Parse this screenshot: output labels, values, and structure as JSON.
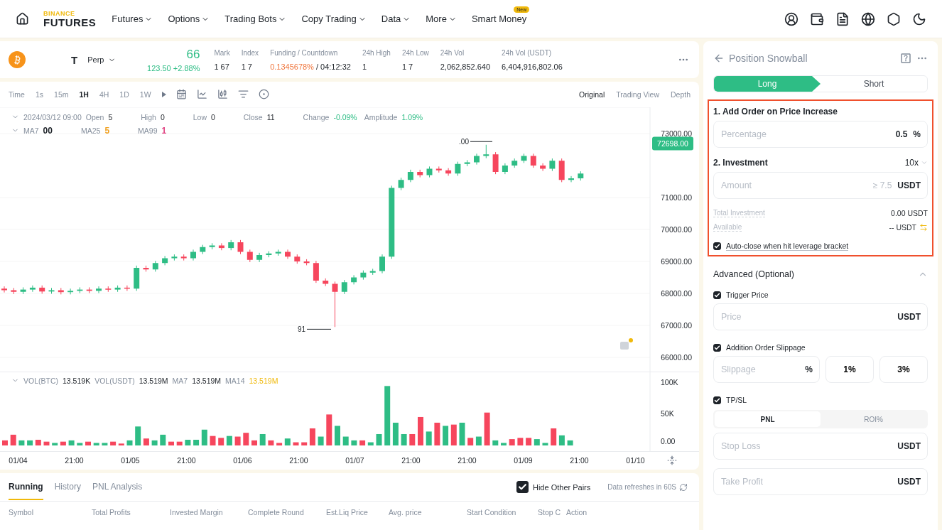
{
  "nav": {
    "logo_top": "BINANCE",
    "logo_bottom": "FUTURES",
    "items": [
      {
        "label": "Futures",
        "dropdown": true
      },
      {
        "label": "Options",
        "dropdown": true
      },
      {
        "label": "Trading Bots",
        "dropdown": true
      },
      {
        "label": "Copy Trading",
        "dropdown": true
      },
      {
        "label": "Data",
        "dropdown": true
      },
      {
        "label": "More",
        "dropdown": true
      },
      {
        "label": "Smart Money",
        "dropdown": false,
        "badge": "New"
      }
    ]
  },
  "ticker": {
    "symbol": "T",
    "contract": "Perp",
    "price": "66",
    "change": "123.50 +2.88%",
    "stats": [
      {
        "label": "Mark",
        "value": "1 67"
      },
      {
        "label": "Index",
        "value": "1 7"
      },
      {
        "label": "Funding / Countdown",
        "value": "0.1345678%",
        "value_2": "/ 04:12:32"
      },
      {
        "label": "24h High",
        "value": "1"
      },
      {
        "label": "24h Low",
        "value": "1 7"
      },
      {
        "label": "24h Vol",
        "value": "2,062,852.640"
      },
      {
        "label": "24h Vol (USDT)",
        "value": "6,404,916,802.06"
      }
    ]
  },
  "chart_toolbar": {
    "intervals": [
      {
        "label": "Time",
        "selected": false
      },
      {
        "label": "1s",
        "selected": false
      },
      {
        "label": "15m",
        "selected": false
      },
      {
        "label": "1H",
        "selected": true
      },
      {
        "label": "4H",
        "selected": false
      },
      {
        "label": "1D",
        "selected": false
      },
      {
        "label": "1W",
        "selected": false
      }
    ],
    "views": [
      {
        "label": "Original",
        "selected": true
      },
      {
        "label": "Trading View",
        "selected": false
      },
      {
        "label": "Depth",
        "selected": false
      }
    ]
  },
  "ohlc": {
    "date": "2024/03/12 09:00",
    "fields": [
      {
        "label": "Open",
        "value": "5",
        "kind": "plain"
      },
      {
        "label": "High",
        "value": "0",
        "kind": "plain"
      },
      {
        "label": "Low",
        "value": "0",
        "kind": "plain"
      },
      {
        "label": "Close",
        "value": "11",
        "kind": "plain"
      },
      {
        "label": "Change",
        "value": "-0.09%",
        "kind": "green"
      },
      {
        "label": "Amplitude",
        "value": "1.09%",
        "kind": "green"
      }
    ]
  },
  "ma": [
    {
      "label": "MA7",
      "value": "00",
      "color": "#1e2329"
    },
    {
      "label": "MA25",
      "value": "5",
      "color": "#f0a020"
    },
    {
      "label": "MA99",
      "value": "1",
      "color": "#e04080"
    }
  ],
  "price_axis": [
    "73000.00",
    "71000.00",
    "70000.00",
    "69000.00",
    "68000.00",
    "67000.00",
    "66000.00"
  ],
  "last_price": "72698.00",
  "markers": {
    "high": ".00",
    "low": "91"
  },
  "volume": {
    "legend": [
      {
        "label": "VOL(BTC)",
        "value": "13.519K",
        "highlight": false
      },
      {
        "label": "VOL(USDT)",
        "value": "13.519M",
        "highlight": false
      },
      {
        "label": "MA7",
        "value": "13.519M",
        "highlight": false
      },
      {
        "label": "MA14",
        "value": "13.519M",
        "highlight": true
      }
    ],
    "axis": [
      "100K",
      "50K",
      "0.00"
    ]
  },
  "time_axis": [
    "01/04",
    "21:00",
    "01/05",
    "21:00",
    "01/06",
    "21:00",
    "01/07",
    "21:00",
    "21:00",
    "01/09",
    "21:00",
    "01/10"
  ],
  "bottom": {
    "tabs": [
      {
        "label": "Running",
        "selected": true
      },
      {
        "label": "History",
        "selected": false
      },
      {
        "label": "PNL Analysis",
        "selected": false
      }
    ],
    "hide_other_pairs": {
      "label": "Hide Other Pairs",
      "checked": true
    },
    "refresh": "Data refreshes in 60S",
    "columns": [
      "Symbol",
      "Total Profits",
      "Invested Margin",
      "Complete Round",
      "Est.Liq Price",
      "Avg. price",
      "Start Condition",
      "Stop C",
      "Action"
    ]
  },
  "panel": {
    "title": "Position Snowball",
    "sides": [
      {
        "label": "Long",
        "selected": true
      },
      {
        "label": "Short",
        "selected": false
      }
    ],
    "step1": {
      "title": "1. Add Order on Price Increase",
      "placeholder": "Percentage",
      "value": "0.5",
      "unit": "%"
    },
    "step2": {
      "title": "2. Investment",
      "leverage": "10x",
      "placeholder": "Amount",
      "hint": "≥ 7.5",
      "unit": "USDT"
    },
    "summary": [
      {
        "label": "Total Investment",
        "value": "0.00 USDT",
        "swap": false
      },
      {
        "label": "Available",
        "value": "-- USDT",
        "swap": true
      }
    ],
    "auto_close": {
      "label": "Auto-close when hit leverage bracket",
      "checked": true
    },
    "advanced": {
      "title": "Advanced (Optional)",
      "expanded": true,
      "trigger": {
        "label": "Trigger Price",
        "checked": true,
        "placeholder": "Price",
        "unit": "USDT"
      },
      "slippage": {
        "label": "Addition Order Slippage",
        "checked": true,
        "placeholder": "Slippage",
        "unit": "%",
        "presets": [
          "1%",
          "3%"
        ]
      },
      "tpsl": {
        "label": "TP/SL",
        "checked": true,
        "modes": [
          {
            "label": "PNL",
            "selected": true
          },
          {
            "label": "ROI%",
            "selected": false
          }
        ],
        "fields": [
          {
            "placeholder": "Stop Loss",
            "unit": "USDT"
          },
          {
            "placeholder": "Take Profit",
            "unit": "USDT"
          }
        ]
      }
    }
  }
}
